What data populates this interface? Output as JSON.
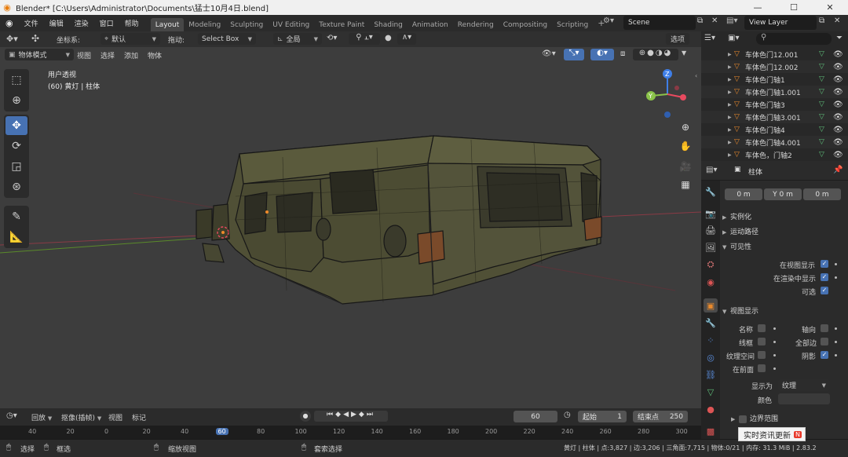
{
  "window": {
    "title": "Blender* [C:\\Users\\Administrator\\Documents\\猛士10月4日.blend]",
    "minimize": "—",
    "maximize": "☐",
    "close": "✕"
  },
  "menu": [
    "文件",
    "编辑",
    "渲染",
    "窗口",
    "帮助"
  ],
  "workspaces": [
    {
      "label": "Layout",
      "active": true
    },
    {
      "label": "Modeling",
      "active": false
    },
    {
      "label": "Sculpting",
      "active": false
    },
    {
      "label": "UV Editing",
      "active": false
    },
    {
      "label": "Texture Paint",
      "active": false
    },
    {
      "label": "Shading",
      "active": false
    },
    {
      "label": "Animation",
      "active": false
    },
    {
      "label": "Rendering",
      "active": false
    },
    {
      "label": "Compositing",
      "active": false
    },
    {
      "label": "Scripting",
      "active": false
    }
  ],
  "add_workspace": "+",
  "scene": {
    "label": "Scene"
  },
  "view_layer": {
    "label": "View Layer"
  },
  "tool_header": {
    "orientation_label": "坐标系:",
    "orientation_value": "默认",
    "drag_label": "拖动:",
    "drag_value": "Select Box",
    "pivot_value": "全局",
    "options": "选项"
  },
  "viewport_header": {
    "mode": "物体模式",
    "items": [
      "视图",
      "选择",
      "添加",
      "物体"
    ]
  },
  "viewport": {
    "view_name": "用户透视",
    "object_info": "(60) 黄灯 | 柱体"
  },
  "gizmo": {
    "x": "X",
    "y": "Y",
    "z": "Z"
  },
  "outliner": {
    "search_placeholder": "",
    "items": [
      "车体色门12.001",
      "车体色门12.002",
      "车体色门轴1",
      "车体色门轴1.001",
      "车体色门轴3",
      "车体色门轴3.001",
      "车体色门轴4",
      "车体色门轴4.001",
      "车体色，门轴2"
    ]
  },
  "properties": {
    "object_name": "柱体",
    "delta_fields": [
      "0 m",
      "Y 0 m",
      "0 m"
    ],
    "panels": {
      "instancing": "实例化",
      "motion_paths": "运动路径",
      "visibility": "可见性",
      "viewport_display": "视图显示",
      "bounds": "边界范围"
    },
    "visibility": {
      "show_in_viewport": "在视图显示",
      "show_in_render": "在渲染中显示",
      "selectable": "可选"
    },
    "viewport_display": {
      "name": "名称",
      "axis": "轴向",
      "wireframe": "线框",
      "all_edges": "全部边",
      "texture_space": "纹理空间",
      "shadow": "阴影",
      "in_front": "在前面",
      "display_as_label": "显示为",
      "display_as_value": "纹理",
      "color": "颜色"
    }
  },
  "timeline": {
    "playback": "回放",
    "keying": "抠像(插帧)",
    "view": "视图",
    "markers": "标记",
    "current_frame": "60",
    "start_label": "起始",
    "start_value": "1",
    "end_label": "结束点",
    "end_value": "250",
    "ruler": [
      "40",
      "20",
      "0",
      "20",
      "40",
      "60",
      "80",
      "100",
      "120",
      "140",
      "160",
      "180",
      "200",
      "220",
      "240",
      "260",
      "280",
      "300"
    ]
  },
  "status": {
    "select": "选择",
    "box_select": "框选",
    "zoom_view": "缩放视图",
    "lasso_select": "套索选择",
    "stats": "黄灯 | 柱体 | 点:3,827 | 边:3,206 | 三角面:7,715 | 物体:0/21 | 内存: 31.3 MiB | 2.83.2",
    "notification": "实时资讯更新",
    "notification_badge": "N"
  },
  "colors": {
    "accent": "#4772b3",
    "viewport_bg": "#3d3d3d",
    "axis_x": "#e84a5f",
    "axis_y": "#8bc34a",
    "axis_z": "#3f7fe8",
    "mesh_green": "#5fbf7a",
    "object_orange": "#e8892c"
  }
}
